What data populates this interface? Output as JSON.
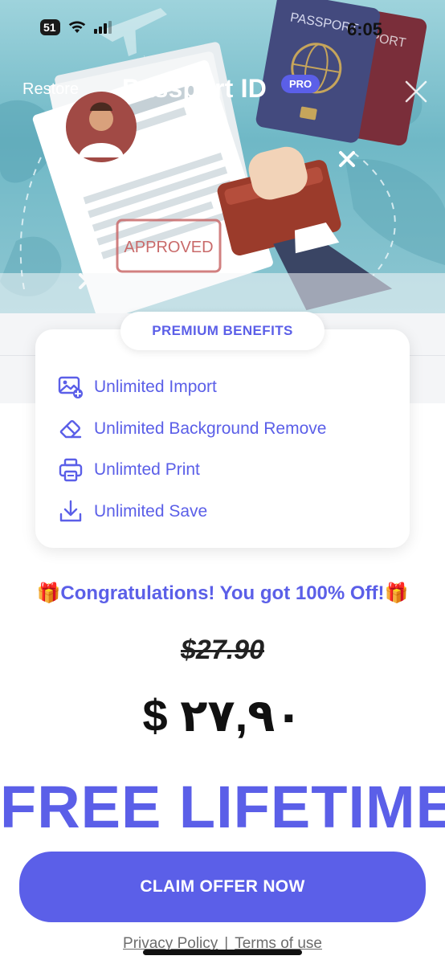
{
  "status_bar": {
    "signal_badge": "51",
    "time": "6:05"
  },
  "header": {
    "restore_label": "Restore",
    "title": "Passport ID",
    "pro_badge": "PRO"
  },
  "hero": {
    "stamp_text": "APPROVED",
    "passport_text_front": "PASSPORT",
    "passport_text_back": "PASSPORT"
  },
  "benefits": {
    "title": "PREMIUM BENEFITS",
    "items": [
      {
        "label": "Unlimited Import",
        "icon": "image-plus-icon"
      },
      {
        "label": "Unlimited Background Remove",
        "icon": "eraser-icon"
      },
      {
        "label": "Unlimted Print",
        "icon": "printer-icon"
      },
      {
        "label": "Unlimited Save",
        "icon": "download-icon"
      }
    ]
  },
  "offer": {
    "congrats": "🎁Congratulations! You got 100% Off!🎁",
    "old_price": "$27.90",
    "new_price": "$ ٢٧,٩٠",
    "headline": "FREE LIFETIME",
    "cta_label": "CLAIM OFFER NOW"
  },
  "footer": {
    "privacy_label": "Privacy Policy",
    "separator": "|",
    "terms_label": "Terms of use"
  },
  "colors": {
    "accent": "#5b5fe8",
    "hero_teal": "#6fb8c6",
    "text_dark": "#111111"
  }
}
